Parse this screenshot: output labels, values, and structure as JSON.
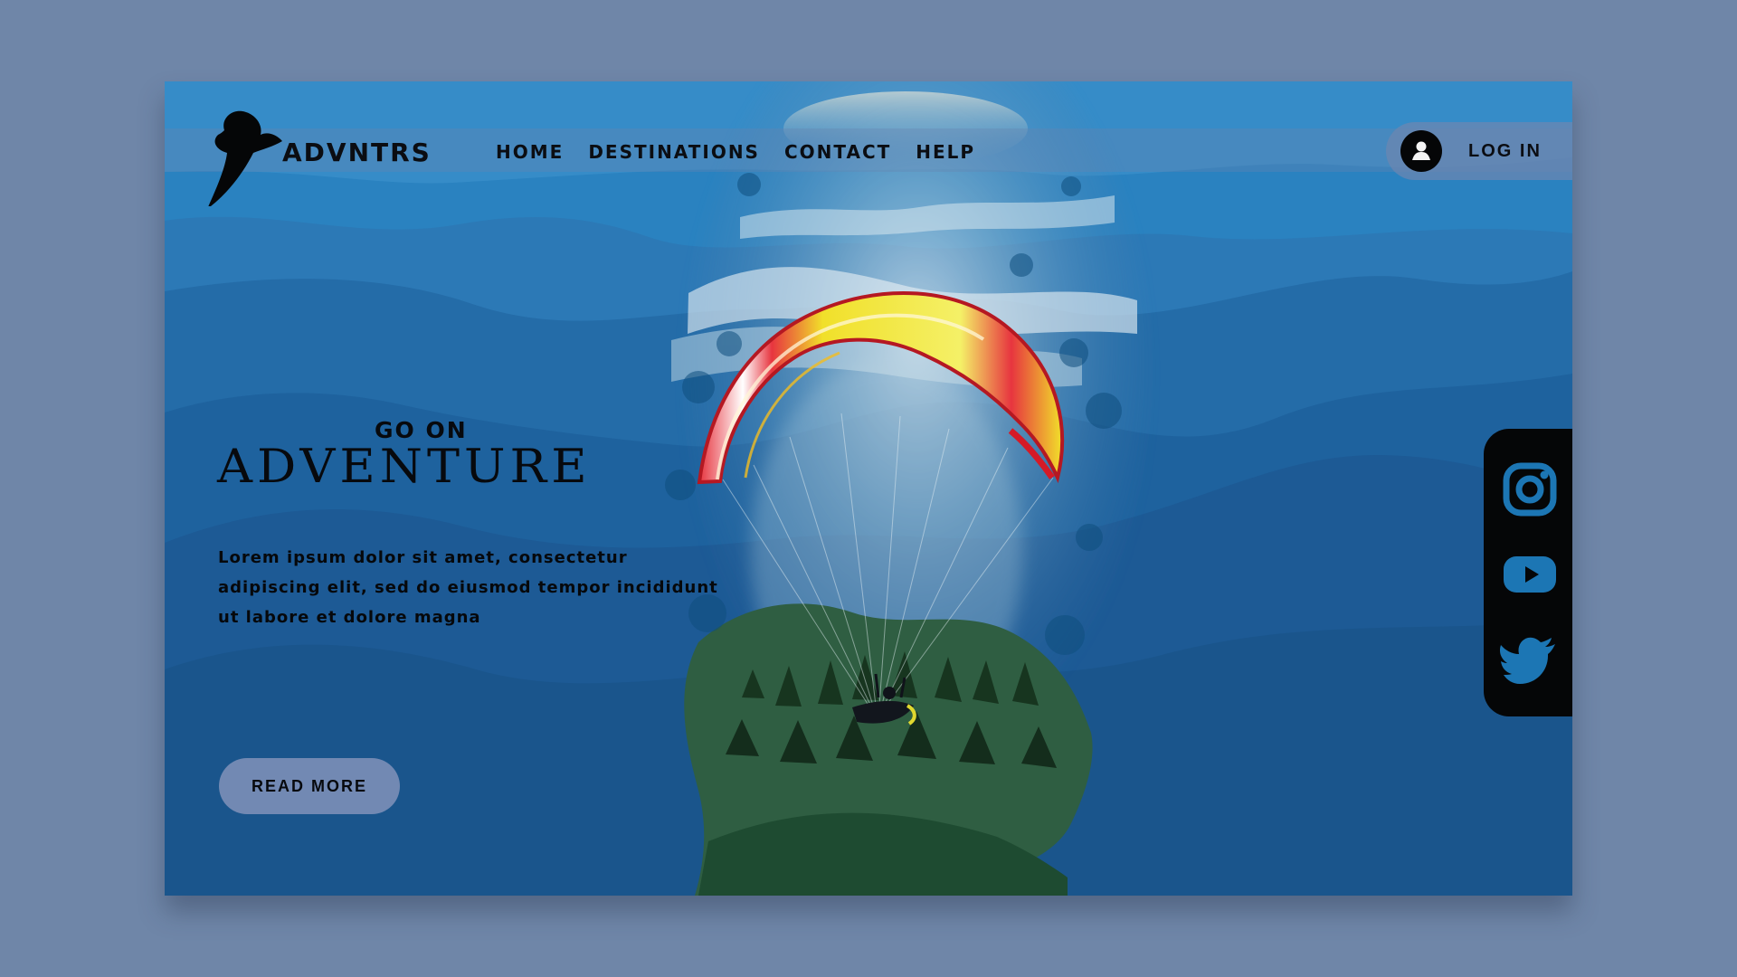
{
  "brand": {
    "name": "ADVNTRS",
    "icon": "paraglider-logo-icon"
  },
  "nav": {
    "items": [
      {
        "label": "HOME"
      },
      {
        "label": "DESTINATIONS"
      },
      {
        "label": "CONTACT"
      },
      {
        "label": "HELP"
      }
    ]
  },
  "account": {
    "login_label": "LOG IN",
    "icon": "user-icon"
  },
  "hero": {
    "kicker": "GO ON",
    "headline": "ADVENTURE",
    "description": "Lorem ipsum dolor sit amet, consectetur adipiscing elit, sed do eiusmod tempor incididunt ut labore et dolore magna",
    "button_label": "READ MORE",
    "image": "paraglider-over-mountains"
  },
  "social": {
    "items": [
      {
        "icon": "instagram-icon"
      },
      {
        "icon": "youtube-icon"
      },
      {
        "icon": "twitter-icon"
      }
    ]
  },
  "colors": {
    "page_background": "#6f86a8",
    "hero_blue": "#1f5f98",
    "sky_blue": "#2f8ac7",
    "nav_overlay": "#6784b0",
    "login_background": "#6d86b0",
    "button_background": "#7289b3",
    "text_dark": "#07090d",
    "social_panel": "#050607",
    "paraglider_red": "#e7353f",
    "paraglider_yellow": "#f1e02a"
  }
}
